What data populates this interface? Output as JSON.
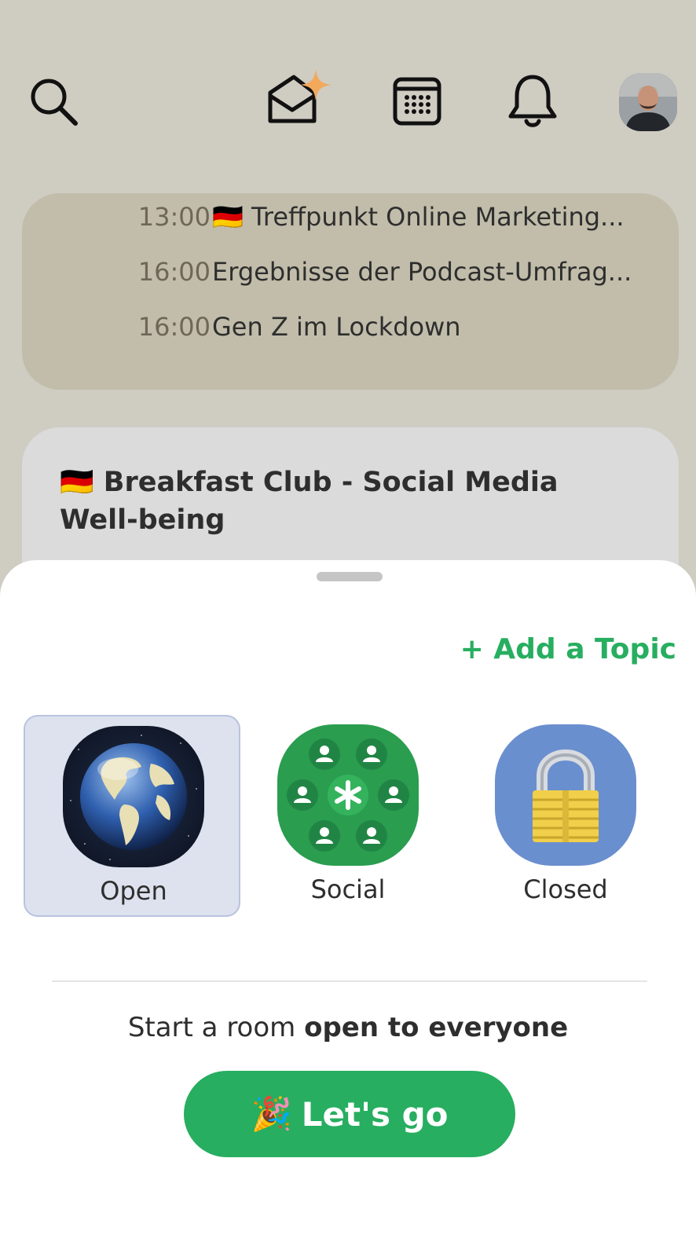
{
  "topbar": {
    "icons": [
      "search-icon",
      "invite-envelope-icon",
      "calendar-icon",
      "bell-icon",
      "avatar"
    ]
  },
  "upcoming": [
    {
      "time": "13:00",
      "title": "🇩🇪 Treffpunkt Online Marketing..."
    },
    {
      "time": "16:00",
      "title": "Ergebnisse der Podcast-Umfrag..."
    },
    {
      "time": "16:00",
      "title": "Gen Z im Lockdown"
    }
  ],
  "room_card": {
    "title": "🇩🇪 Breakfast Club - Social Media Well-being"
  },
  "sheet": {
    "add_topic": "+ Add a Topic",
    "types": [
      {
        "label": "Open",
        "icon": "globe-icon",
        "selected": true
      },
      {
        "label": "Social",
        "icon": "social-group-icon",
        "selected": false
      },
      {
        "label": "Closed",
        "icon": "lock-icon",
        "selected": false
      }
    ],
    "start_prefix": "Start a room ",
    "start_bold": "open to everyone",
    "go_emoji": "🎉",
    "go_label": "Let's go"
  },
  "colors": {
    "background": "#cfccc2",
    "accent_green": "#27ae60",
    "selected_tile": "#dde2ee"
  }
}
